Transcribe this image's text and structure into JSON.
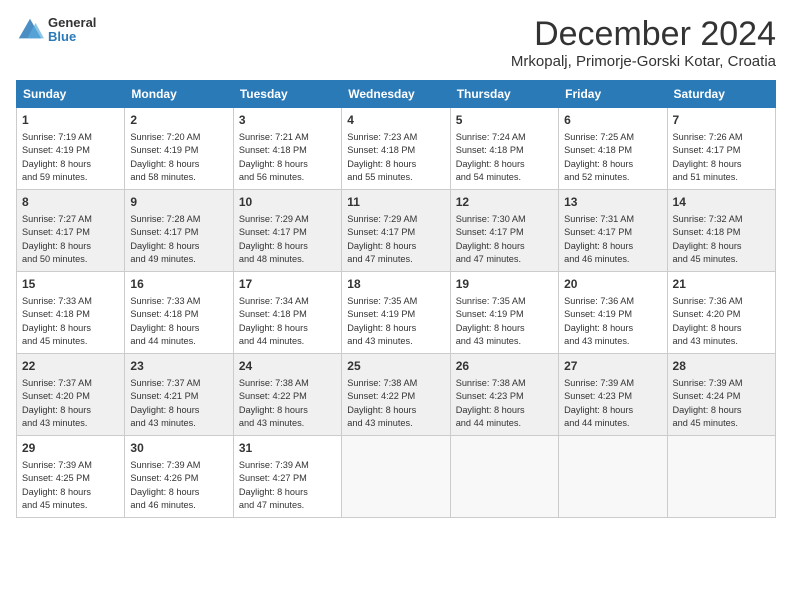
{
  "logo": {
    "general": "General",
    "blue": "Blue"
  },
  "title": "December 2024",
  "location": "Mrkopalj, Primorje-Gorski Kotar, Croatia",
  "days": [
    "Sunday",
    "Monday",
    "Tuesday",
    "Wednesday",
    "Thursday",
    "Friday",
    "Saturday"
  ],
  "weeks": [
    [
      {
        "date": "1",
        "sunrise": "7:19 AM",
        "sunset": "4:19 PM",
        "daylight": "8 hours and 59 minutes."
      },
      {
        "date": "2",
        "sunrise": "7:20 AM",
        "sunset": "4:19 PM",
        "daylight": "8 hours and 58 minutes."
      },
      {
        "date": "3",
        "sunrise": "7:21 AM",
        "sunset": "4:18 PM",
        "daylight": "8 hours and 56 minutes."
      },
      {
        "date": "4",
        "sunrise": "7:23 AM",
        "sunset": "4:18 PM",
        "daylight": "8 hours and 55 minutes."
      },
      {
        "date": "5",
        "sunrise": "7:24 AM",
        "sunset": "4:18 PM",
        "daylight": "8 hours and 54 minutes."
      },
      {
        "date": "6",
        "sunrise": "7:25 AM",
        "sunset": "4:18 PM",
        "daylight": "8 hours and 52 minutes."
      },
      {
        "date": "7",
        "sunrise": "7:26 AM",
        "sunset": "4:17 PM",
        "daylight": "8 hours and 51 minutes."
      }
    ],
    [
      {
        "date": "8",
        "sunrise": "7:27 AM",
        "sunset": "4:17 PM",
        "daylight": "8 hours and 50 minutes."
      },
      {
        "date": "9",
        "sunrise": "7:28 AM",
        "sunset": "4:17 PM",
        "daylight": "8 hours and 49 minutes."
      },
      {
        "date": "10",
        "sunrise": "7:29 AM",
        "sunset": "4:17 PM",
        "daylight": "8 hours and 48 minutes."
      },
      {
        "date": "11",
        "sunrise": "7:29 AM",
        "sunset": "4:17 PM",
        "daylight": "8 hours and 47 minutes."
      },
      {
        "date": "12",
        "sunrise": "7:30 AM",
        "sunset": "4:17 PM",
        "daylight": "8 hours and 47 minutes."
      },
      {
        "date": "13",
        "sunrise": "7:31 AM",
        "sunset": "4:17 PM",
        "daylight": "8 hours and 46 minutes."
      },
      {
        "date": "14",
        "sunrise": "7:32 AM",
        "sunset": "4:18 PM",
        "daylight": "8 hours and 45 minutes."
      }
    ],
    [
      {
        "date": "15",
        "sunrise": "7:33 AM",
        "sunset": "4:18 PM",
        "daylight": "8 hours and 45 minutes."
      },
      {
        "date": "16",
        "sunrise": "7:33 AM",
        "sunset": "4:18 PM",
        "daylight": "8 hours and 44 minutes."
      },
      {
        "date": "17",
        "sunrise": "7:34 AM",
        "sunset": "4:18 PM",
        "daylight": "8 hours and 44 minutes."
      },
      {
        "date": "18",
        "sunrise": "7:35 AM",
        "sunset": "4:19 PM",
        "daylight": "8 hours and 43 minutes."
      },
      {
        "date": "19",
        "sunrise": "7:35 AM",
        "sunset": "4:19 PM",
        "daylight": "8 hours and 43 minutes."
      },
      {
        "date": "20",
        "sunrise": "7:36 AM",
        "sunset": "4:19 PM",
        "daylight": "8 hours and 43 minutes."
      },
      {
        "date": "21",
        "sunrise": "7:36 AM",
        "sunset": "4:20 PM",
        "daylight": "8 hours and 43 minutes."
      }
    ],
    [
      {
        "date": "22",
        "sunrise": "7:37 AM",
        "sunset": "4:20 PM",
        "daylight": "8 hours and 43 minutes."
      },
      {
        "date": "23",
        "sunrise": "7:37 AM",
        "sunset": "4:21 PM",
        "daylight": "8 hours and 43 minutes."
      },
      {
        "date": "24",
        "sunrise": "7:38 AM",
        "sunset": "4:22 PM",
        "daylight": "8 hours and 43 minutes."
      },
      {
        "date": "25",
        "sunrise": "7:38 AM",
        "sunset": "4:22 PM",
        "daylight": "8 hours and 43 minutes."
      },
      {
        "date": "26",
        "sunrise": "7:38 AM",
        "sunset": "4:23 PM",
        "daylight": "8 hours and 44 minutes."
      },
      {
        "date": "27",
        "sunrise": "7:39 AM",
        "sunset": "4:23 PM",
        "daylight": "8 hours and 44 minutes."
      },
      {
        "date": "28",
        "sunrise": "7:39 AM",
        "sunset": "4:24 PM",
        "daylight": "8 hours and 45 minutes."
      }
    ],
    [
      {
        "date": "29",
        "sunrise": "7:39 AM",
        "sunset": "4:25 PM",
        "daylight": "8 hours and 45 minutes."
      },
      {
        "date": "30",
        "sunrise": "7:39 AM",
        "sunset": "4:26 PM",
        "daylight": "8 hours and 46 minutes."
      },
      {
        "date": "31",
        "sunrise": "7:39 AM",
        "sunset": "4:27 PM",
        "daylight": "8 hours and 47 minutes."
      },
      null,
      null,
      null,
      null
    ]
  ]
}
